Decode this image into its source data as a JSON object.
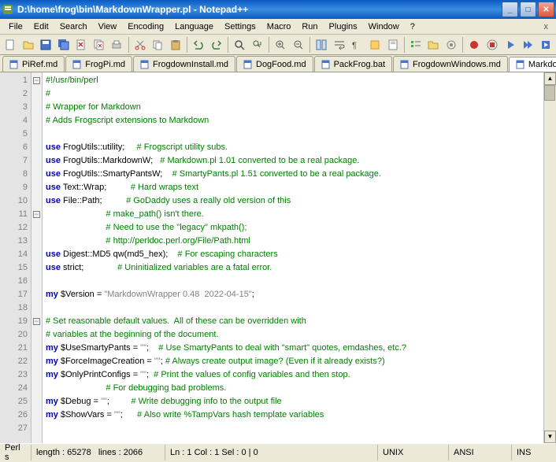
{
  "title": "D:\\home\\frog\\bin\\MarkdownWrapper.pl - Notepad++",
  "menu": [
    "File",
    "Edit",
    "Search",
    "View",
    "Encoding",
    "Language",
    "Settings",
    "Macro",
    "Run",
    "Plugins",
    "Window",
    "?"
  ],
  "tabs": [
    {
      "label": "PiRef.md"
    },
    {
      "label": "FrogPi.md"
    },
    {
      "label": "FrogdownInstall.md"
    },
    {
      "label": "DogFood.md"
    },
    {
      "label": "PackFrog.bat"
    },
    {
      "label": "FrogdownWindows.md"
    },
    {
      "label": "MarkdownWrapper.pl",
      "active": true
    }
  ],
  "lines": [
    {
      "n": 1,
      "t": "#!/usr/bin/perl",
      "cls": "cm"
    },
    {
      "n": 2,
      "t": "#",
      "cls": "cm"
    },
    {
      "n": 3,
      "t": "# Wrapper for Markdown",
      "cls": "cm"
    },
    {
      "n": 4,
      "t": "# Adds Frogscript extensions to Markdown",
      "cls": "cm"
    },
    {
      "n": 5,
      "t": "",
      "cls": ""
    },
    {
      "n": 6,
      "html": "<span class='kw'>use</span> FrogUtils::utility;     <span class='cm'># Frogscript utility subs.</span>"
    },
    {
      "n": 7,
      "html": "<span class='kw'>use</span> FrogUtils::MarkdownW;   <span class='cm'># Markdown.pl 1.01 converted to be a real package.</span>"
    },
    {
      "n": 8,
      "html": "<span class='kw'>use</span> FrogUtils::SmartyPantsW;    <span class='cm'># SmartyPants.pl 1.51 converted to be a real package.</span>"
    },
    {
      "n": 9,
      "html": "<span class='kw'>use</span> Text::Wrap;          <span class='cm'># Hard wraps text</span>"
    },
    {
      "n": 10,
      "html": "<span class='kw'>use</span> File::Path;          <span class='cm'># GoDaddy uses a really old version of this</span>"
    },
    {
      "n": 11,
      "html": "                         <span class='cm'># make_path() isn't there.</span>"
    },
    {
      "n": 12,
      "html": "                         <span class='cm'># Need to use the \"legacy\" mkpath();</span>"
    },
    {
      "n": 13,
      "html": "                         <span class='cm'># http://perldoc.perl.org/File/Path.html</span>"
    },
    {
      "n": 14,
      "html": "<span class='kw'>use</span> Digest::MD5 qw(md5_hex);    <span class='cm'># For escaping characters</span>"
    },
    {
      "n": 15,
      "html": "<span class='kw'>use</span> strict;              <span class='cm'># Uninitialized variables are a fatal error.</span>"
    },
    {
      "n": 16,
      "t": "",
      "cls": ""
    },
    {
      "n": 17,
      "html": "<span class='kw'>my</span> <span class='var'>$Version</span> = <span class='str'>\"MarkdownWrapper 0.48  2022-04-15\"</span>;"
    },
    {
      "n": 18,
      "t": "",
      "cls": ""
    },
    {
      "n": 19,
      "html": "<span class='cm'># Set reasonable default values.  All of these can be overridden with</span>"
    },
    {
      "n": 20,
      "html": "<span class='cm'># variables at the beginning of the document.</span>"
    },
    {
      "n": 21,
      "html": "<span class='kw'>my</span> <span class='var'>$UseSmartyPants</span> = <span class='str'>\"\"</span>;    <span class='cm'># Use SmartyPants to deal with \"smart\" quotes, emdashes, etc.?</span>"
    },
    {
      "n": 22,
      "html": "<span class='kw'>my</span> <span class='var'>$ForceImageCreation</span> = <span class='str'>\"\"</span>; <span class='cm'># Always create output image? (Even if it already exists?)</span>"
    },
    {
      "n": 23,
      "html": "<span class='kw'>my</span> <span class='var'>$OnlyPrintConfigs</span> = <span class='str'>\"\"</span>;  <span class='cm'># Print the values of config variables and then stop.</span>"
    },
    {
      "n": 24,
      "html": "                         <span class='cm'># For debugging bad problems.</span>"
    },
    {
      "n": 25,
      "html": "<span class='kw'>my</span> <span class='var'>$Debug</span> = <span class='str'>\"\"</span>;         <span class='cm'># Write debugging info to the output file</span>"
    },
    {
      "n": 26,
      "html": "<span class='kw'>my</span> <span class='var'>$ShowVars</span> = <span class='str'>\"\"</span>;      <span class='cm'># Also write %TampVars hash template variables</span>"
    },
    {
      "n": 27,
      "t": "",
      "cls": ""
    }
  ],
  "status": {
    "lang": "Perl s",
    "length": "length : 65278",
    "lines": "lines : 2066",
    "pos": "Ln : 1   Col : 1   Sel : 0 | 0",
    "eol": "UNIX",
    "enc": "ANSI",
    "ins": "INS"
  }
}
